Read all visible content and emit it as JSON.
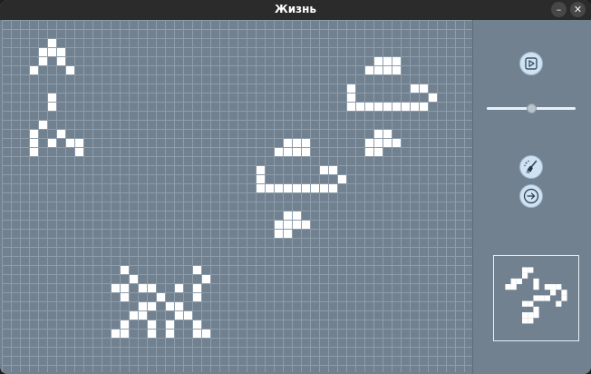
{
  "window": {
    "title": "Жизнь",
    "minimize_glyph": "–",
    "close_glyph": "✕"
  },
  "colors": {
    "background": "#718190",
    "grid_line": "#8e9dab",
    "cell_alive": "#ffffff",
    "button_fill": "#cfe2f3",
    "icon_stroke": "#24384d"
  },
  "controls": {
    "play_icon": "play-icon",
    "clear_icon": "broom-icon",
    "step_icon": "arrow-right-icon",
    "speed_value": 0.5
  },
  "board": {
    "columns": 52,
    "rows": 39,
    "alive": [
      [
        5,
        2
      ],
      [
        4,
        3
      ],
      [
        5,
        3
      ],
      [
        6,
        3
      ],
      [
        4,
        4
      ],
      [
        6,
        4
      ],
      [
        3,
        5
      ],
      [
        7,
        5
      ],
      [
        5,
        8
      ],
      [
        5,
        9
      ],
      [
        4,
        11
      ],
      [
        3,
        12
      ],
      [
        6,
        12
      ],
      [
        3,
        13
      ],
      [
        5,
        13
      ],
      [
        7,
        13
      ],
      [
        8,
        13
      ],
      [
        3,
        14
      ],
      [
        8,
        14
      ],
      [
        41,
        4
      ],
      [
        42,
        4
      ],
      [
        43,
        4
      ],
      [
        40,
        5
      ],
      [
        41,
        5
      ],
      [
        42,
        5
      ],
      [
        43,
        5
      ],
      [
        38,
        7
      ],
      [
        45,
        7
      ],
      [
        46,
        7
      ],
      [
        38,
        8
      ],
      [
        47,
        8
      ],
      [
        38,
        9
      ],
      [
        39,
        9
      ],
      [
        40,
        9
      ],
      [
        41,
        9
      ],
      [
        42,
        9
      ],
      [
        43,
        9
      ],
      [
        44,
        9
      ],
      [
        45,
        9
      ],
      [
        46,
        9
      ],
      [
        41,
        12
      ],
      [
        42,
        12
      ],
      [
        40,
        13
      ],
      [
        41,
        13
      ],
      [
        42,
        13
      ],
      [
        43,
        13
      ],
      [
        40,
        14
      ],
      [
        41,
        14
      ],
      [
        31,
        13
      ],
      [
        32,
        13
      ],
      [
        33,
        13
      ],
      [
        30,
        14
      ],
      [
        31,
        14
      ],
      [
        32,
        14
      ],
      [
        33,
        14
      ],
      [
        28,
        16
      ],
      [
        35,
        16
      ],
      [
        36,
        16
      ],
      [
        28,
        17
      ],
      [
        37,
        17
      ],
      [
        28,
        18
      ],
      [
        29,
        18
      ],
      [
        30,
        18
      ],
      [
        31,
        18
      ],
      [
        32,
        18
      ],
      [
        33,
        18
      ],
      [
        34,
        18
      ],
      [
        35,
        18
      ],
      [
        36,
        18
      ],
      [
        31,
        21
      ],
      [
        32,
        21
      ],
      [
        30,
        22
      ],
      [
        31,
        22
      ],
      [
        32,
        22
      ],
      [
        33,
        22
      ],
      [
        30,
        23
      ],
      [
        31,
        23
      ],
      [
        13,
        27
      ],
      [
        21,
        27
      ],
      [
        14,
        28
      ],
      [
        22,
        28
      ],
      [
        12,
        29
      ],
      [
        13,
        29
      ],
      [
        15,
        29
      ],
      [
        16,
        29
      ],
      [
        19,
        29
      ],
      [
        21,
        29
      ],
      [
        13,
        30
      ],
      [
        17,
        30
      ],
      [
        21,
        30
      ],
      [
        15,
        31
      ],
      [
        16,
        31
      ],
      [
        18,
        31
      ],
      [
        19,
        31
      ],
      [
        14,
        32
      ],
      [
        15,
        32
      ],
      [
        19,
        32
      ],
      [
        20,
        32
      ],
      [
        13,
        33
      ],
      [
        16,
        33
      ],
      [
        18,
        33
      ],
      [
        21,
        33
      ],
      [
        12,
        34
      ],
      [
        13,
        34
      ],
      [
        16,
        34
      ],
      [
        18,
        34
      ],
      [
        21,
        34
      ],
      [
        22,
        34
      ]
    ]
  },
  "preview": {
    "columns": 15,
    "rows": 15,
    "alive": [
      [
        5,
        2
      ],
      [
        6,
        2
      ],
      [
        5,
        3
      ],
      [
        3,
        4
      ],
      [
        4,
        4
      ],
      [
        7,
        4
      ],
      [
        2,
        5
      ],
      [
        3,
        5
      ],
      [
        7,
        5
      ],
      [
        9,
        5
      ],
      [
        10,
        5
      ],
      [
        11,
        5
      ],
      [
        10,
        6
      ],
      [
        12,
        6
      ],
      [
        7,
        7
      ],
      [
        8,
        7
      ],
      [
        9,
        7
      ],
      [
        12,
        7
      ],
      [
        5,
        8
      ],
      [
        6,
        8
      ],
      [
        11,
        8
      ],
      [
        7,
        9
      ],
      [
        5,
        10
      ],
      [
        6,
        10
      ],
      [
        7,
        10
      ],
      [
        5,
        11
      ],
      [
        6,
        11
      ]
    ]
  }
}
